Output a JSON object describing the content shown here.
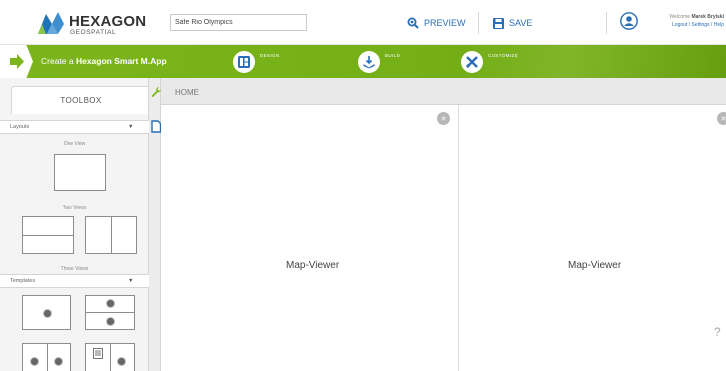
{
  "header": {
    "brand": "HEXAGON",
    "brand_sub": "GEOSPATIAL",
    "app_name_value": "Safe Rio Olympics",
    "preview_label": "PREVIEW",
    "save_label": "SAVE",
    "user_welcome": "Welcome",
    "user_name": "Marek Brylski",
    "user_links": "Logout / Settings / Help",
    "accent_color": "#2a6fb5"
  },
  "wizard": {
    "create_prefix": "Create a ",
    "create_bold": "Hexagon Smart M.App",
    "steps": [
      {
        "label": "DESIGN"
      },
      {
        "label": "BUILD"
      },
      {
        "label": "CUSTOMIZE"
      }
    ],
    "bar_color": "#7bb51b"
  },
  "toolbox": {
    "title": "TOOLBOX",
    "layouts_label": "Layouts",
    "one_view": "One View",
    "two_views": "Two Views",
    "three_views": "Three Views",
    "templates_label": "Templates"
  },
  "content": {
    "breadcrumb": "HOME",
    "viewers": [
      {
        "label": "Map-Viewer"
      },
      {
        "label": "Map-Viewer"
      }
    ],
    "help": "?"
  }
}
